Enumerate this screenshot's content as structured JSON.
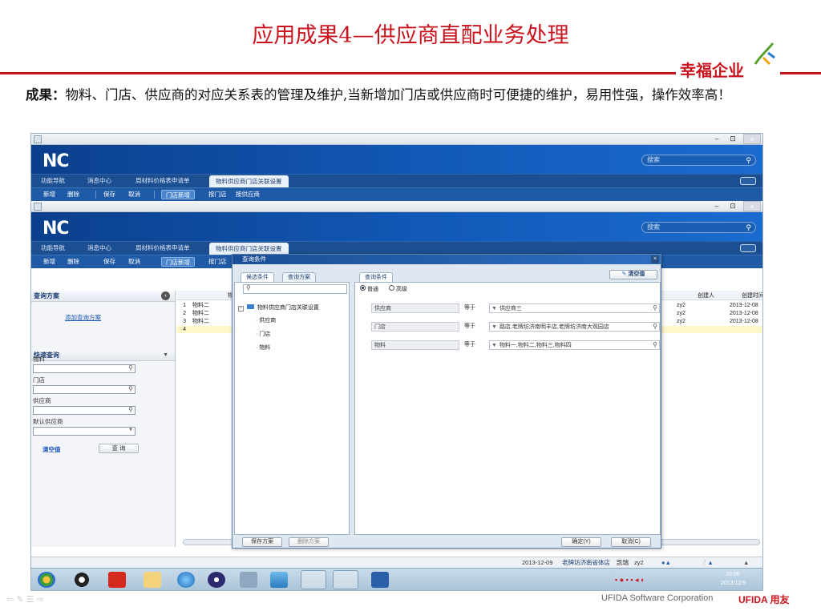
{
  "slide": {
    "title": "应用成果4—供应商直配业务处理",
    "logo_text": "幸福企业",
    "desc_label": "成果：",
    "desc_text": "物料、门店、供应商的对应关系表的管理及维护,当新增加门店或供应商时可便捷的维护，易用性强，操作效率高！",
    "footer_company": "UFIDA Software Corporation",
    "footer_brand": "UFIDA 用友"
  },
  "colors": {
    "accent": "#c8141e",
    "nc_blue": "#1259b8",
    "link": "#1b55b5"
  },
  "app": {
    "logo": "NC",
    "search_placeholder": "搜索",
    "window_buttons": [
      "–",
      "⊡",
      "×"
    ],
    "nav": {
      "items": [
        "功能导航",
        "消息中心",
        "周材料价格表申请单"
      ],
      "active_tab": "物料供应商门店关联设置"
    },
    "toolbar": [
      "新增",
      "删除",
      "保存",
      "取消",
      "门店新增",
      "按门店",
      "按供应商"
    ]
  },
  "left_panel": {
    "query_plan_title": "查询方案",
    "add_plan_link": "添加查询方案",
    "quick_query_title": "快速查询",
    "fields": [
      "物料",
      "门店",
      "供应商",
      "默认供应商"
    ],
    "clear_button": "清空值",
    "query_button": "查 询"
  },
  "grid": {
    "col_material": "物料",
    "col_creator": "创建人",
    "col_created_time": "创建时间",
    "rows": [
      {
        "num": "1",
        "material": "物料二",
        "creator": "zy2",
        "time": "2013-12-08"
      },
      {
        "num": "2",
        "material": "物料二",
        "creator": "zy2",
        "time": "2013-12-08"
      },
      {
        "num": "3",
        "material": "物料二",
        "creator": "zy2",
        "time": "2013-12-08"
      },
      {
        "num": "4",
        "material": "",
        "creator": "",
        "time": ""
      }
    ]
  },
  "dialog": {
    "title": "查询条件",
    "left_tabs": [
      "候选条件",
      "查询方案"
    ],
    "search_icon": "search-icon",
    "tree_root": "物料供应商门店关联设置",
    "tree_children": [
      "供应商",
      "门店",
      "物料"
    ],
    "right_tab": "查询条件",
    "clear_button": "清空值",
    "mode_normal": "普通",
    "mode_advanced": "高级",
    "conditions": [
      {
        "field": "供应商",
        "op": "等于",
        "value": "供应商三"
      },
      {
        "field": "门店",
        "op": "等于",
        "value": "路店,老牌坊济南明丰店,老牌坊济南大观园店"
      },
      {
        "field": "物料",
        "op": "等于",
        "value": "物料一,物料二,物料三,物料四"
      }
    ],
    "save_plan": "保存方案",
    "delete_plan": "删除方案",
    "ok": "确定(Y)",
    "cancel": "取消(C)"
  },
  "status_bar": {
    "date": "2013-12-09",
    "store": "老牌坊济南省体店",
    "user_label": "凯瑞",
    "user": "zy2"
  },
  "taskbar": {
    "time": "10:06",
    "date": "2013/12/9"
  }
}
